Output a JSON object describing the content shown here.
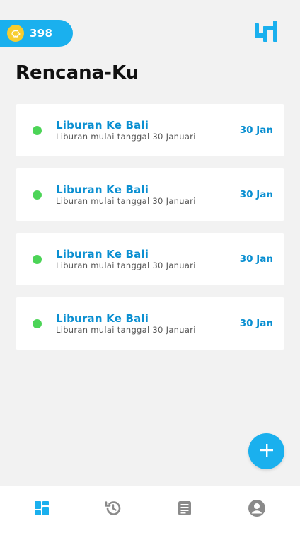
{
  "header": {
    "coin_count": "398",
    "coin_icon": "piggy-bank-coin-icon",
    "logo_icon": "app-logo-icon"
  },
  "page": {
    "title": "Rencana-Ku"
  },
  "plans": [
    {
      "title": "Liburan Ke Bali",
      "subtitle": "Liburan mulai tanggal 30 Januari",
      "date": "30 Jan",
      "status_color": "#4cd457"
    },
    {
      "title": "Liburan Ke Bali",
      "subtitle": "Liburan mulai tanggal 30 Januari",
      "date": "30 Jan",
      "status_color": "#4cd457"
    },
    {
      "title": "Liburan Ke Bali",
      "subtitle": "Liburan mulai tanggal 30 Januari",
      "date": "30 Jan",
      "status_color": "#4cd457"
    },
    {
      "title": "Liburan Ke Bali",
      "subtitle": "Liburan mulai tanggal 30 Januari",
      "date": "30 Jan",
      "status_color": "#4cd457"
    }
  ],
  "fab": {
    "icon": "plus-icon"
  },
  "bottom_nav": [
    {
      "icon": "dashboard-icon",
      "active": true
    },
    {
      "icon": "history-icon",
      "active": false
    },
    {
      "icon": "article-icon",
      "active": false
    },
    {
      "icon": "profile-icon",
      "active": false
    }
  ],
  "colors": {
    "accent": "#1ab0ee",
    "link": "#0a8fd1",
    "status_green": "#4cd457",
    "coin": "#f7cd2e",
    "nav_inactive": "#8a8a8a"
  }
}
